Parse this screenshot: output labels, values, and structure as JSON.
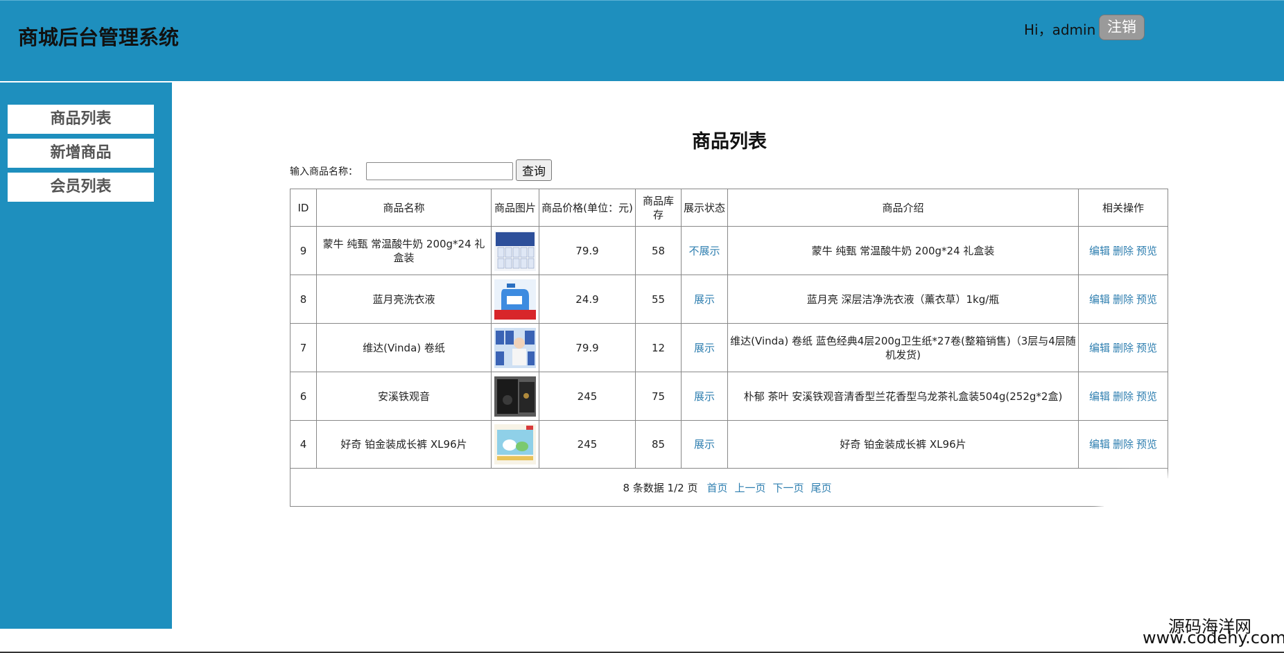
{
  "header": {
    "title": "商城后台管理系统",
    "greeting": "Hi，admin",
    "logout_label": "注销"
  },
  "sidebar": {
    "items": [
      {
        "label": "商品列表"
      },
      {
        "label": "新增商品"
      },
      {
        "label": "会员列表"
      }
    ]
  },
  "main": {
    "title": "商品列表",
    "search": {
      "label": "输入商品名称：",
      "value": "",
      "placeholder": "",
      "button_label": "查询"
    },
    "table": {
      "columns": [
        "ID",
        "商品名称",
        "商品图片",
        "商品价格(单位：元)",
        "商品库存",
        "展示状态",
        "商品介绍",
        "相关操作"
      ],
      "rows": [
        {
          "id": "9",
          "name": "蒙牛 纯甄 常温酸牛奶 200g*24 礼盒装",
          "image": "milk-box-image",
          "price": "79.9",
          "stock": "58",
          "status": "不展示",
          "intro": "蒙牛 纯甄 常温酸牛奶 200g*24 礼盒装"
        },
        {
          "id": "8",
          "name": "蓝月亮洗衣液",
          "image": "detergent-image",
          "price": "24.9",
          "stock": "55",
          "status": "展示",
          "intro": "蓝月亮 深层洁净洗衣液（薰衣草）1kg/瓶"
        },
        {
          "id": "7",
          "name": "维达(Vinda) 卷纸",
          "image": "tissue-image",
          "price": "79.9",
          "stock": "12",
          "status": "展示",
          "intro": "维达(Vinda) 卷纸 蓝色经典4层200g卫生纸*27卷(整箱销售)（3层与4层随机发货)"
        },
        {
          "id": "6",
          "name": "安溪铁观音",
          "image": "tea-box-image",
          "price": "245",
          "stock": "75",
          "status": "展示",
          "intro": "朴郁 茶叶 安溪铁观音清香型兰花香型乌龙茶礼盒装504g(252g*2盒)"
        },
        {
          "id": "4",
          "name": "好奇 铂金装成长裤 XL96片",
          "image": "diaper-image",
          "price": "245",
          "stock": "85",
          "status": "展示",
          "intro": "好奇 铂金装成长裤 XL96片"
        }
      ],
      "actions": {
        "edit": "编辑",
        "delete": "删除",
        "preview": "预览"
      }
    },
    "pagination": {
      "summary": "8 条数据 1/2 页",
      "first": "首页",
      "prev": "上一页",
      "next": "下一页",
      "last": "尾页"
    }
  },
  "watermark": {
    "cn": "源码海洋网",
    "url": "www.codehy.com"
  },
  "colors": {
    "header_bg": "#1e8fbe",
    "sidebar_bg": "#1e8fbe",
    "link": "#2f7fb0",
    "logout_bg": "#9a9a9a"
  }
}
